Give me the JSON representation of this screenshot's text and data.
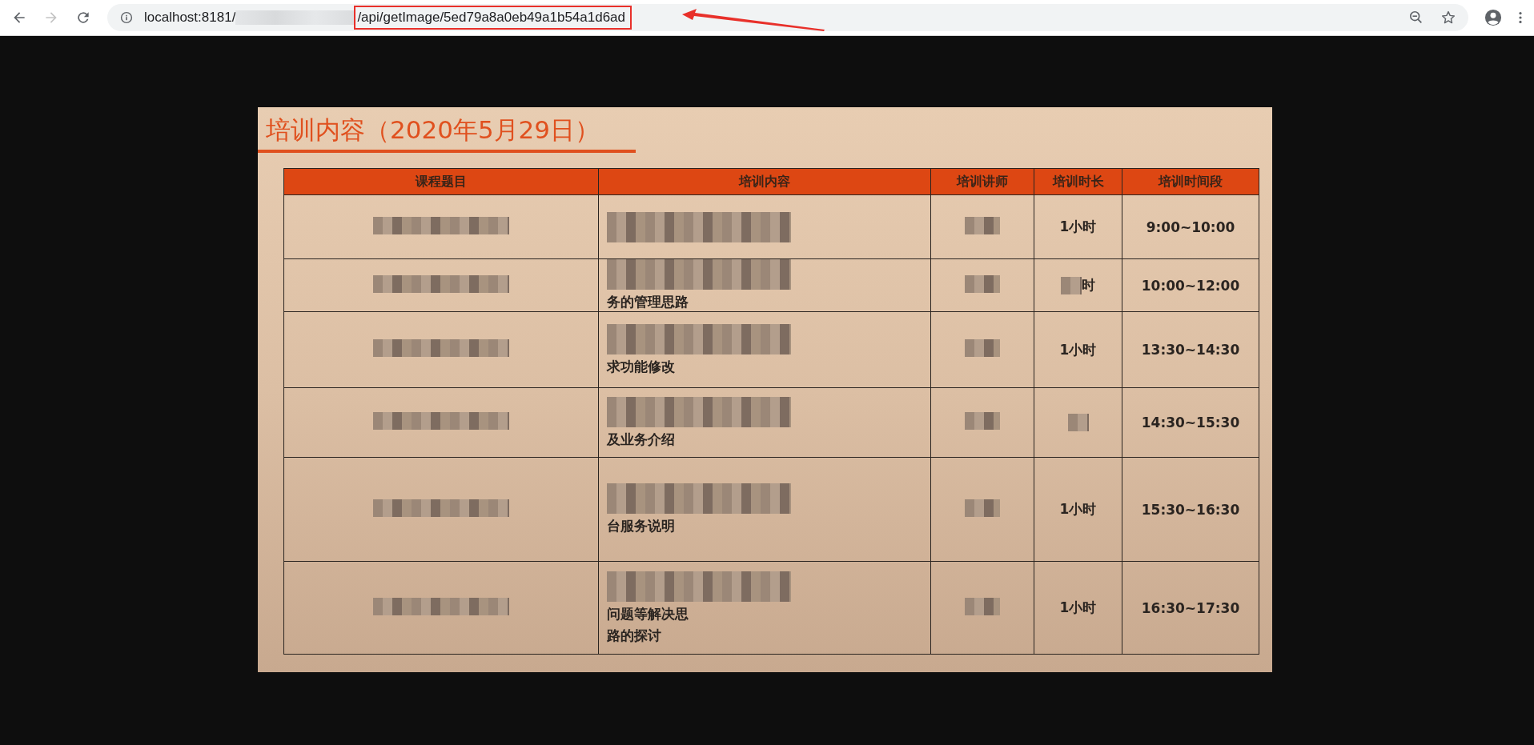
{
  "browser": {
    "back_disabled": false,
    "forward_disabled": true,
    "url": {
      "host": "localhost:8181/",
      "redacted_middle": true,
      "path": "/api/getImage/5ed79a8a0eb49a1b54a1d6ad",
      "highlighted": true
    }
  },
  "slide": {
    "title": "培训内容（2020年5月29日）",
    "table": {
      "columns": [
        "课程题目",
        "培训内容",
        "培训讲师",
        "培训时长",
        "培训时间段"
      ],
      "rows": [
        {
          "title": {
            "redacted": true
          },
          "content": {
            "redacted": true
          },
          "lecturer": {
            "redacted": true
          },
          "duration": {
            "text": "1小时",
            "redacted": false
          },
          "time": "9:00~10:00"
        },
        {
          "title": {
            "redacted": true
          },
          "content": {
            "lines": [
              "务的管理思路"
            ],
            "redacted": true
          },
          "lecturer": {
            "redacted": true
          },
          "duration": {
            "text": "时",
            "redacted": true
          },
          "time": "10:00~12:00"
        },
        {
          "title": {
            "redacted": true
          },
          "content": {
            "lines": [
              "求功能修改"
            ],
            "redacted": true
          },
          "lecturer": {
            "redacted": true
          },
          "duration": {
            "text": "1小时",
            "redacted": false
          },
          "time": "13:30~14:30"
        },
        {
          "title": {
            "redacted": true
          },
          "content": {
            "lines": [
              "及业务介绍"
            ],
            "redacted": true
          },
          "lecturer": {
            "redacted": true
          },
          "duration": {
            "redacted": true
          },
          "time": "14:30~15:30"
        },
        {
          "title": {
            "redacted": true
          },
          "content": {
            "lines": [
              "台服务说明"
            ],
            "redacted": true
          },
          "lecturer": {
            "redacted": true
          },
          "duration": {
            "text": "1小时",
            "redacted": false
          },
          "time": "15:30~16:30"
        },
        {
          "title": {
            "redacted": true
          },
          "content": {
            "lines": [
              "问题等解决思",
              "路的探讨"
            ],
            "redacted": true
          },
          "lecturer": {
            "redacted": true
          },
          "duration": {
            "text": "1小时",
            "redacted": false
          },
          "time": "16:30~17:30"
        }
      ]
    }
  }
}
